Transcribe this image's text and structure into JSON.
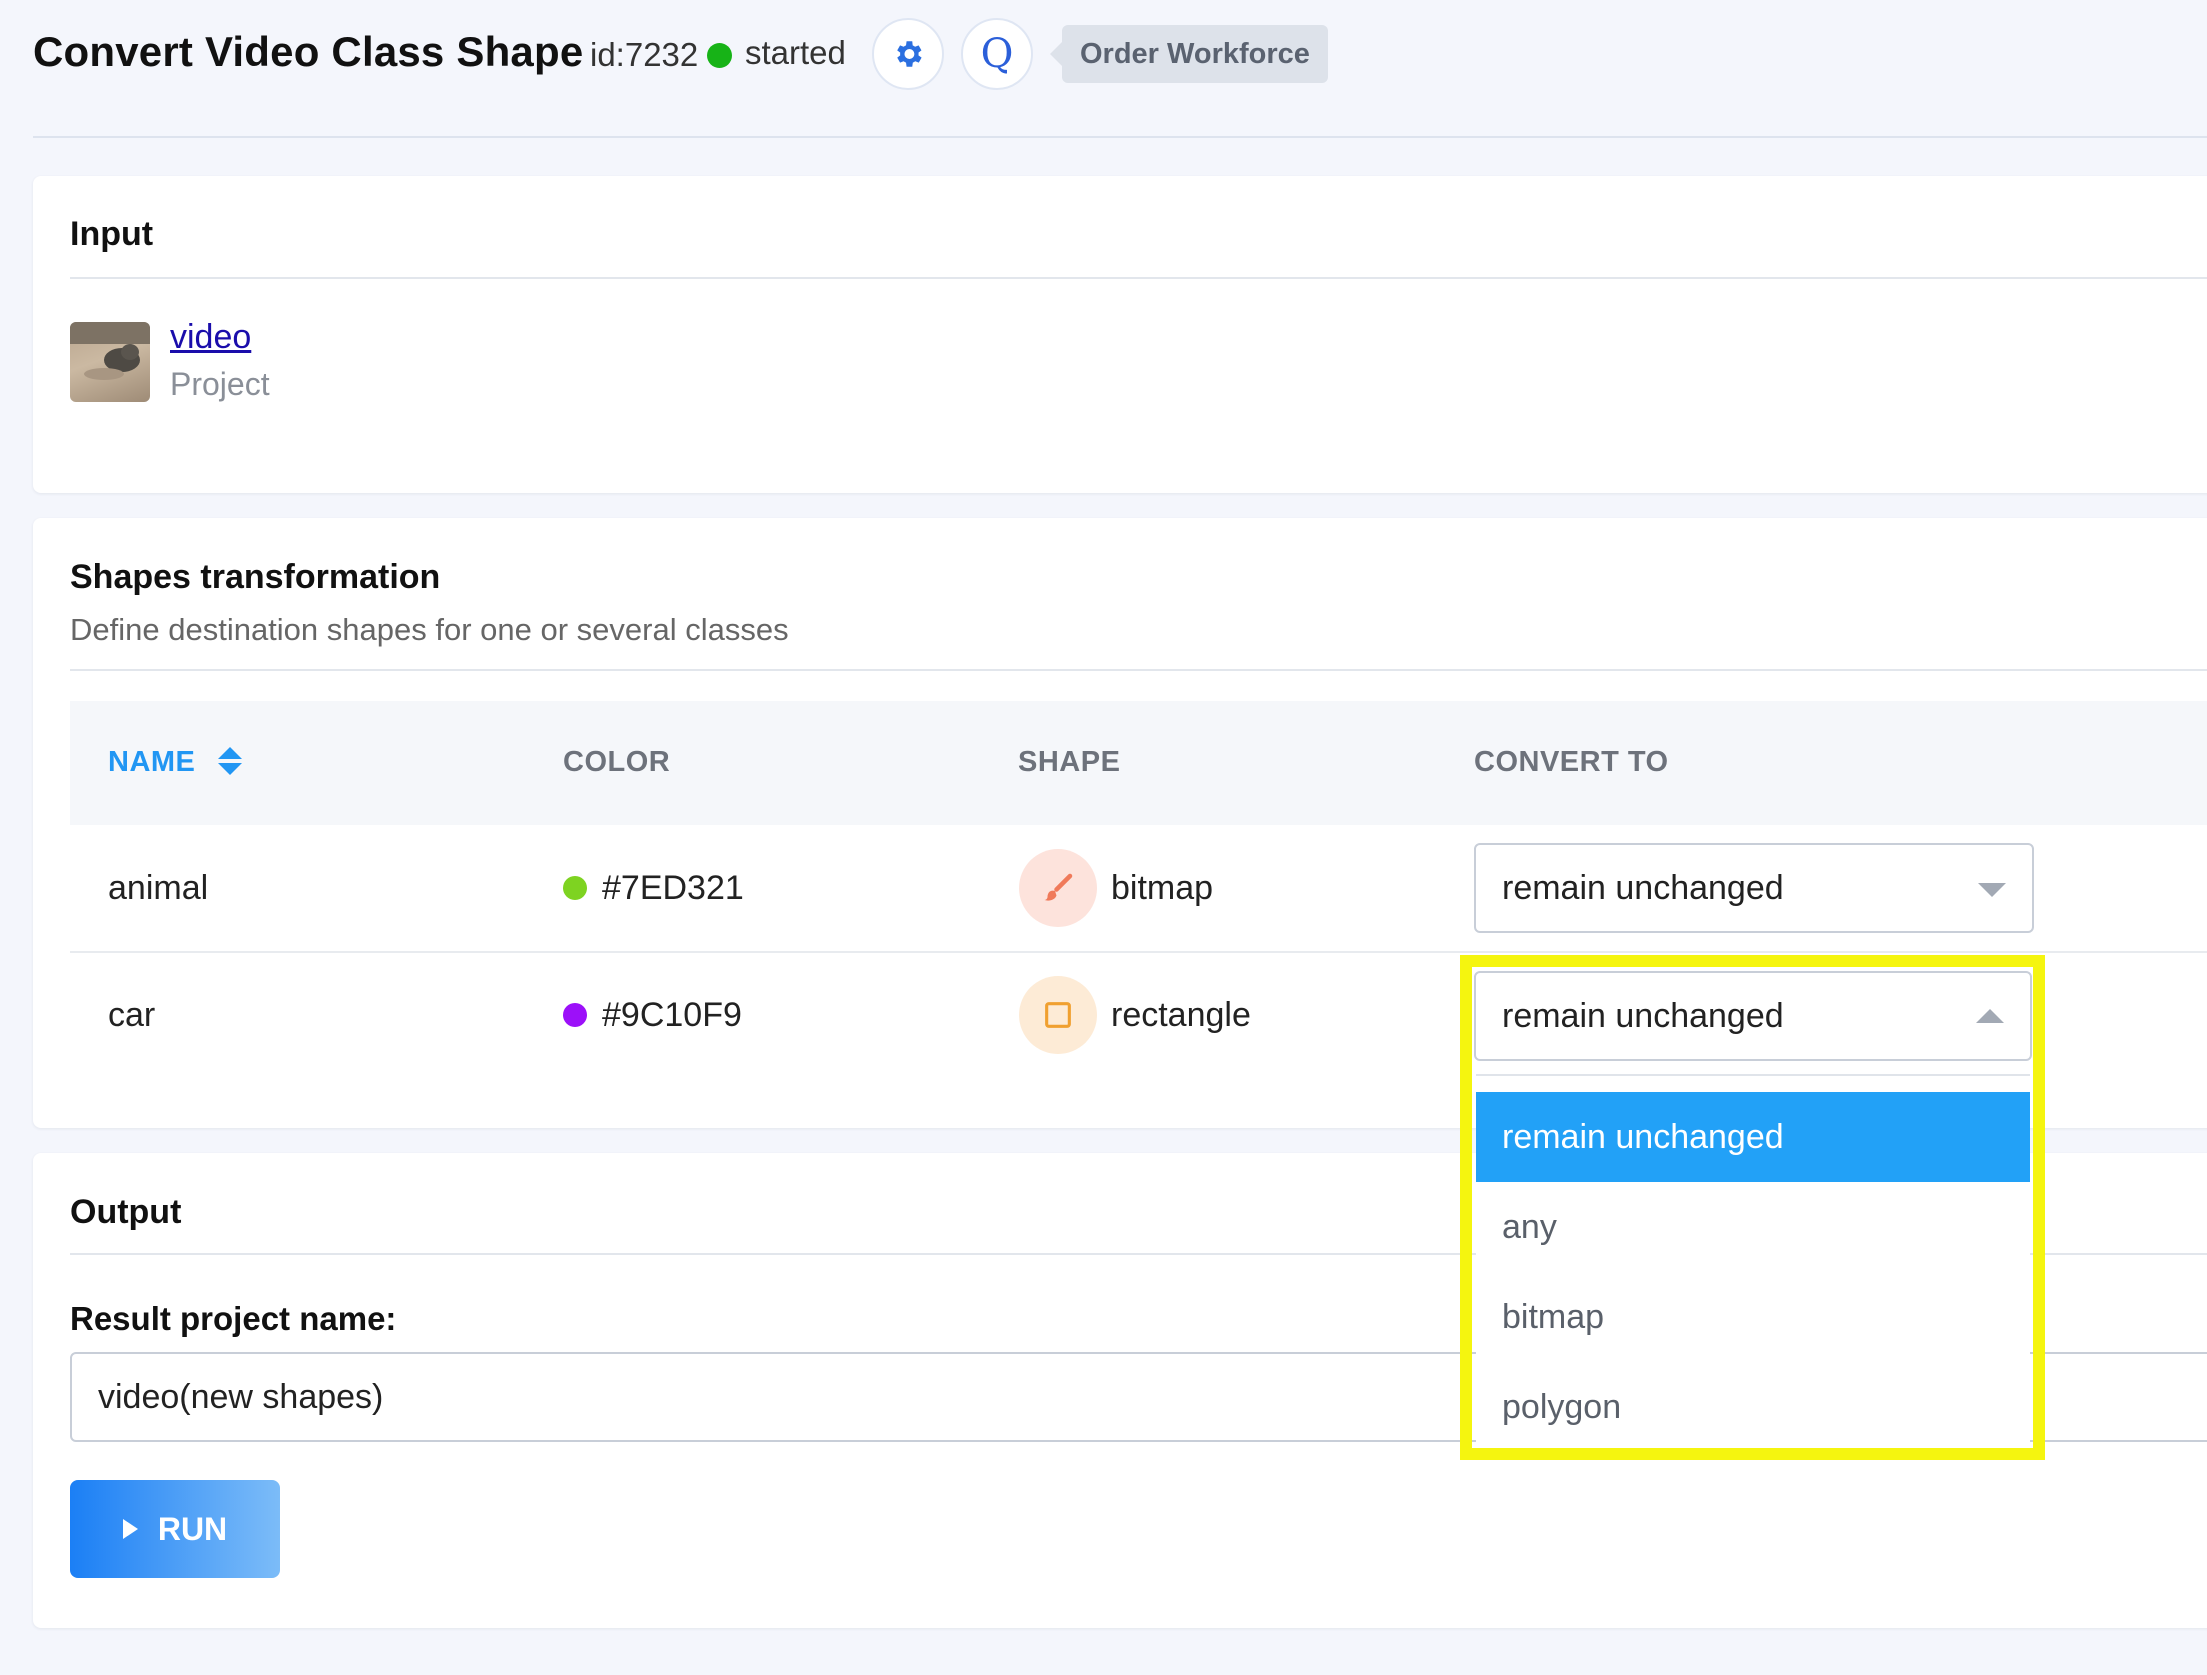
{
  "header": {
    "title": "Convert Video Class Shape",
    "task_id": "id:7232",
    "status": "started",
    "status_color": "#17b317",
    "gear_icon": "gear-icon",
    "q_button_label": "Q",
    "badge_label": "Order Workforce"
  },
  "input_card": {
    "title": "Input",
    "item": {
      "link_text": "video",
      "sublabel": "Project"
    }
  },
  "shapes_card": {
    "title": "Shapes transformation",
    "subtitle": "Define destination shapes for one or several classes",
    "columns": [
      "NAME",
      "COLOR",
      "SHAPE",
      "CONVERT TO"
    ],
    "rows": [
      {
        "name": "animal",
        "color": "#7ED321",
        "shape": "bitmap",
        "shape_icon": "brush-icon",
        "convert_to": "remain unchanged"
      },
      {
        "name": "car",
        "color": "#9C10F9",
        "shape": "rectangle",
        "shape_icon": "square-icon",
        "convert_to": "remain unchanged"
      }
    ],
    "dropdown_options": [
      "remain unchanged",
      "any",
      "bitmap",
      "polygon"
    ],
    "dropdown_selected": "remain unchanged"
  },
  "output_card": {
    "title": "Output",
    "result_label": "Result project name:",
    "result_value": "video(new shapes)",
    "run_label": "RUN"
  },
  "colors": {
    "accent": "#2196f3",
    "dropdown_selected_bg": "#22a1f7",
    "highlight": "#f5f50f"
  }
}
